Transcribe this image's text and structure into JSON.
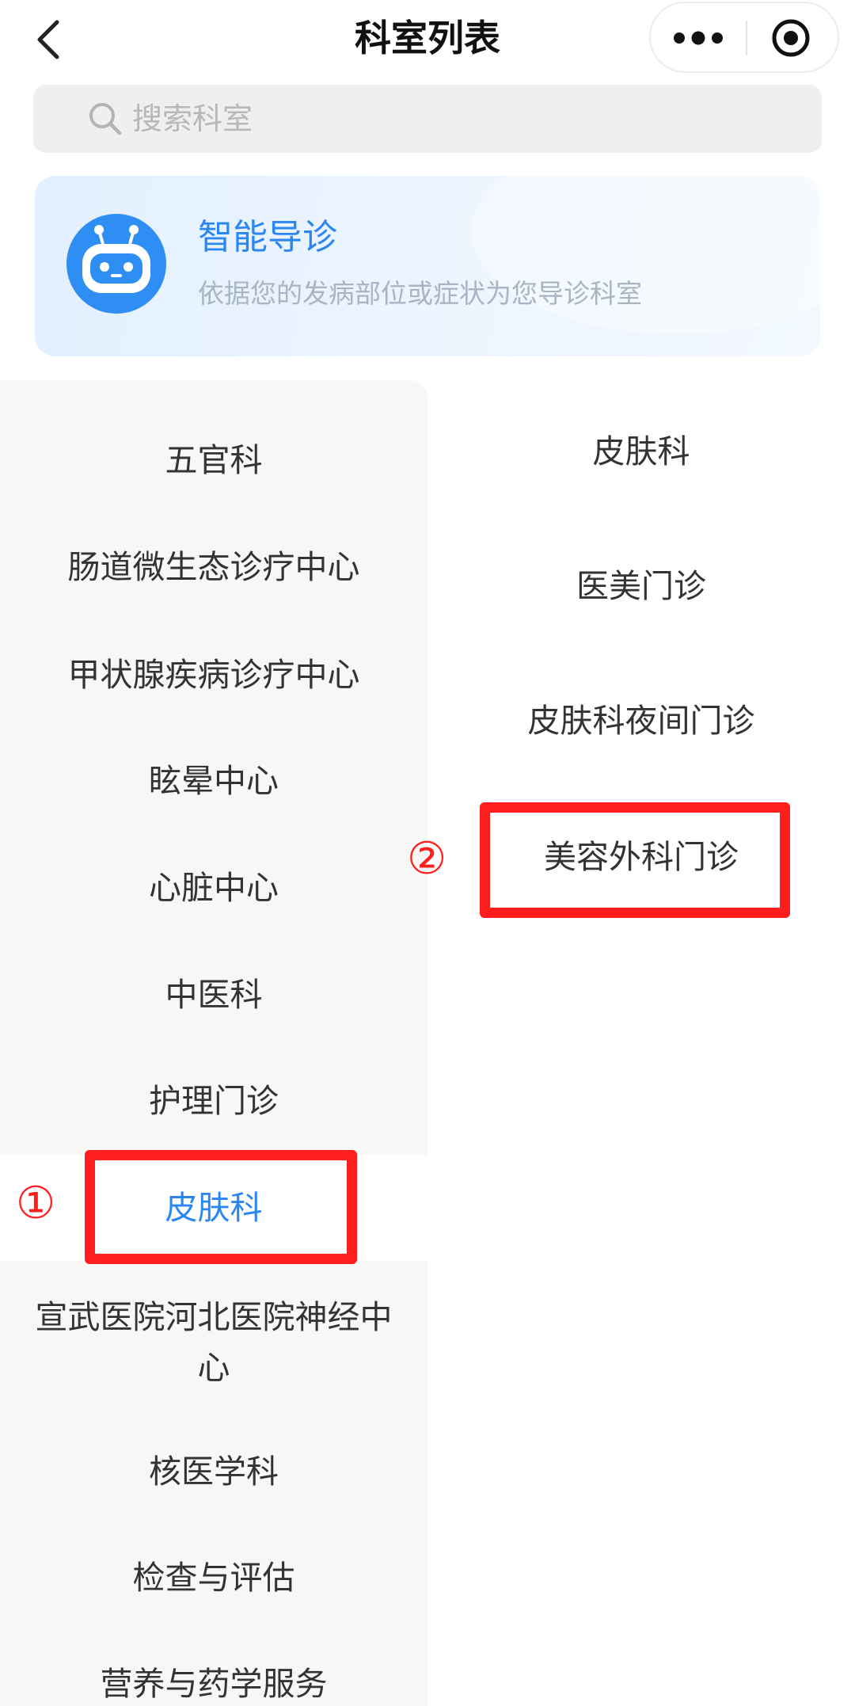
{
  "nav": {
    "title": "科室列表",
    "back_icon": "chevron-left-icon",
    "more_icon": "more-dots-icon",
    "close_icon": "target-close-icon"
  },
  "search": {
    "placeholder": "搜索科室",
    "icon": "search-icon"
  },
  "guide": {
    "title": "智能导诊",
    "desc": "依据您的发病部位或症状为您导诊科室",
    "icon": "robot-icon"
  },
  "left_list": [
    "五官科",
    "肠道微生态诊疗中心",
    "甲状腺疾病诊疗中心",
    "眩晕中心",
    "心脏中心",
    "中医科",
    "护理门诊",
    "皮肤科",
    "宣武医院河北医院神经中心",
    "核医学科",
    "检查与评估",
    "营养与药学服务"
  ],
  "right_list": [
    "皮肤科",
    "医美门诊",
    "皮肤科夜间门诊",
    "美容外科门诊"
  ],
  "annotations": {
    "step1": "①",
    "step2": "②"
  },
  "colors": {
    "accent": "#2a86f0",
    "annotation": "#ff1d1d",
    "sidebar_bg": "#f7f7f5"
  }
}
